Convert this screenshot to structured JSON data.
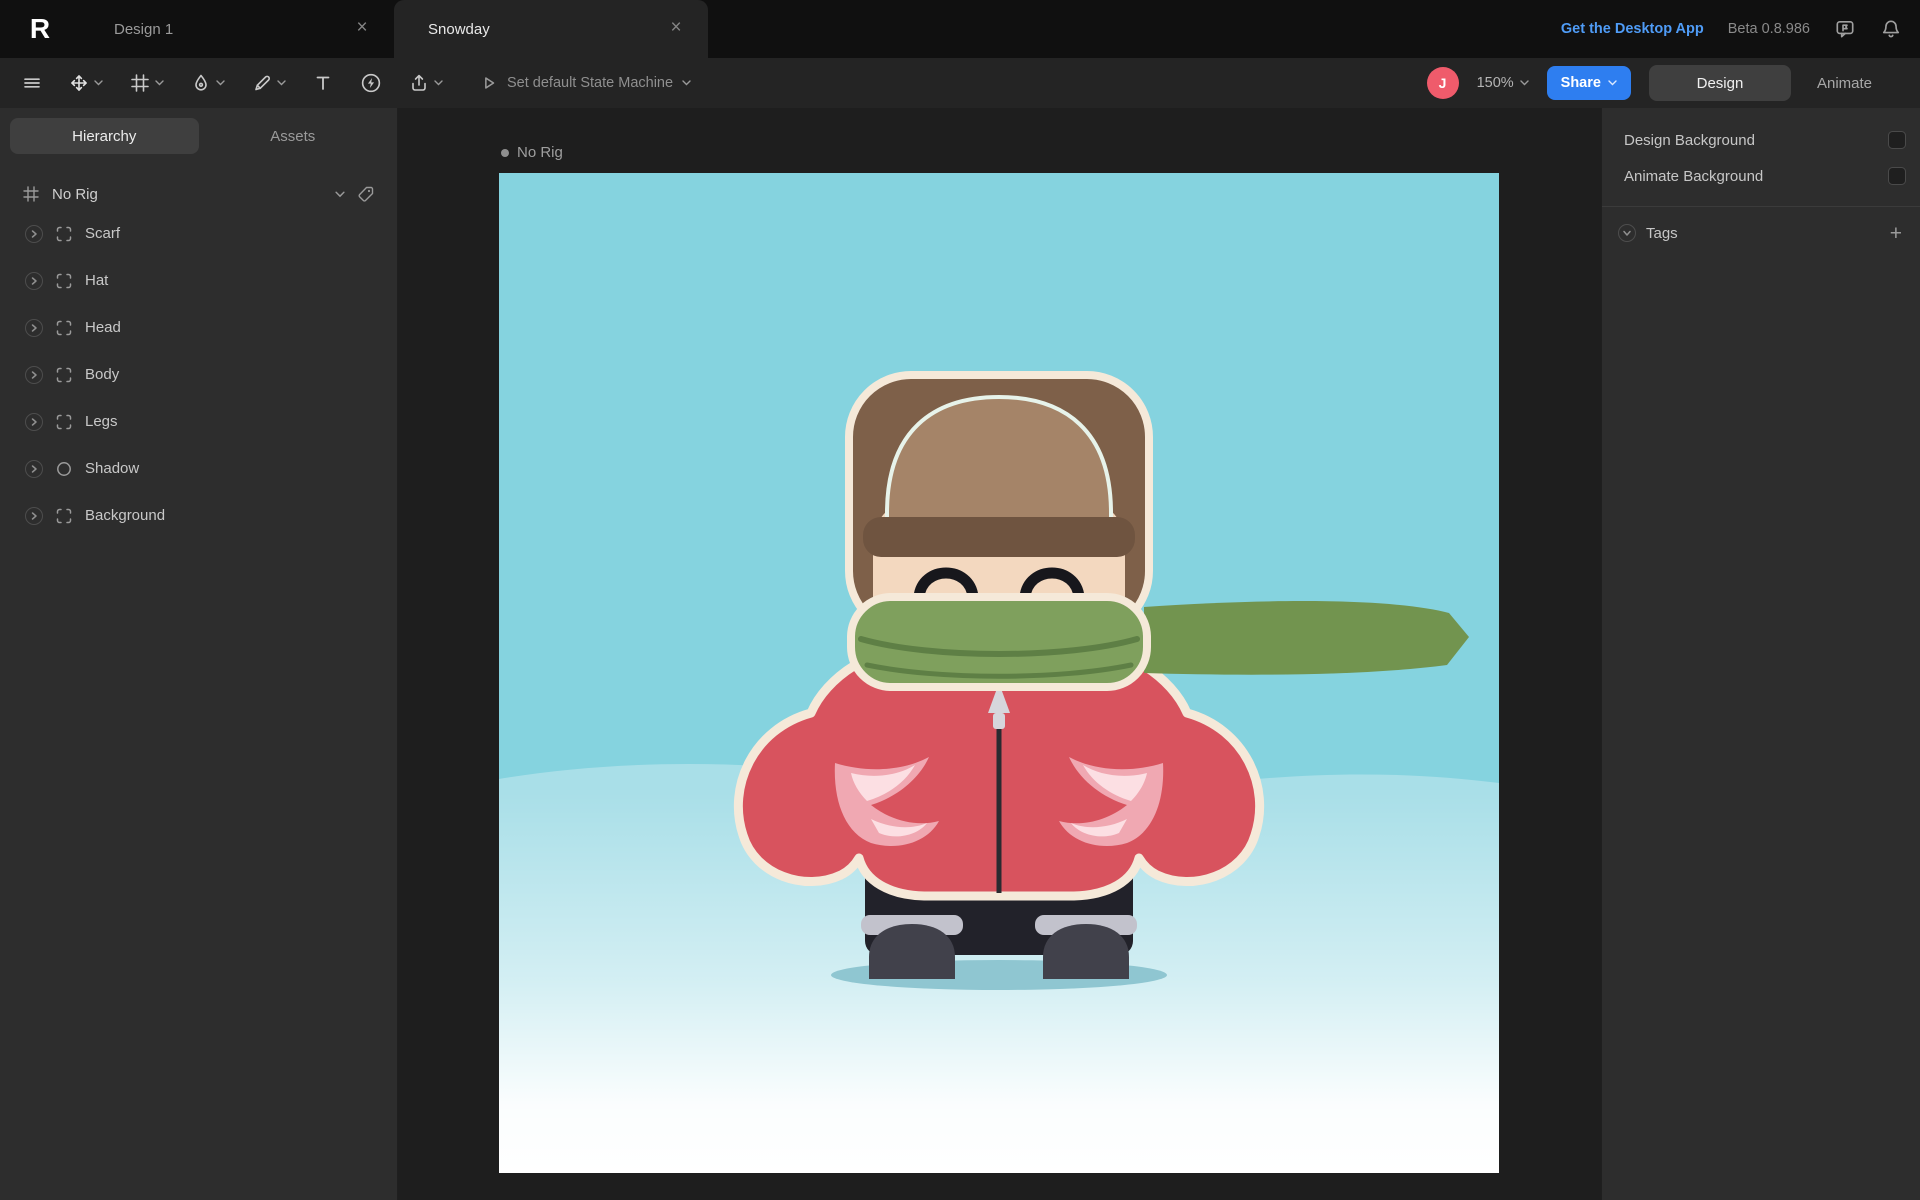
{
  "app": {
    "logo": "R"
  },
  "tabbar": {
    "tabs": [
      {
        "label": "Design 1",
        "close": "×"
      },
      {
        "label": "Snowday",
        "close": "×"
      }
    ],
    "desktop_link": "Get the Desktop App",
    "beta": "Beta 0.8.986",
    "icons": [
      "feedback-icon",
      "bell-icon"
    ]
  },
  "toolbar": {
    "icons": [
      "menu",
      "transform-tool",
      "artboard-tool",
      "pen-tool",
      "pencil-tool",
      "text-tool",
      "actions",
      "export",
      "play"
    ],
    "state_machine_label": "Set default State Machine",
    "avatar_initial": "J",
    "zoom": "150%",
    "share_label": "Share",
    "design_label": "Design",
    "animate_label": "Animate",
    "colors": {
      "share_blue": "#2e7ef0",
      "avatar_pink": "#ef5b6b",
      "link_blue": "#4f9cf7"
    }
  },
  "sidebar": {
    "tabs": {
      "hierarchy": "Hierarchy",
      "assets": "Assets"
    },
    "active_tab": "Hierarchy",
    "rig_selector": "No Rig",
    "tree": [
      {
        "label": "Scarf",
        "icon": "group-icon"
      },
      {
        "label": "Hat",
        "icon": "group-icon"
      },
      {
        "label": "Head",
        "icon": "group-icon"
      },
      {
        "label": "Body",
        "icon": "group-icon"
      },
      {
        "label": "Legs",
        "icon": "group-icon"
      },
      {
        "label": "Shadow",
        "icon": "ellipse-icon"
      },
      {
        "label": "Background",
        "icon": "group-icon"
      }
    ]
  },
  "canvas": {
    "artboard_label": "No Rig"
  },
  "right_panel": {
    "rows": [
      "Design Background",
      "Animate Background"
    ],
    "tags_label": "Tags",
    "swatch_color": "#1f1f1f"
  },
  "artwork": {
    "description": "winter character on snowy artboard",
    "colors": {
      "sky": "#85d3df",
      "hill": "#a9dfe8",
      "ground_shadow": "#8fc6d1",
      "hat_outer": "#7e6049",
      "hat_inner": "#a58468",
      "hat_front_outline": "#e7f3ea",
      "hat_brim": "#6f5440",
      "face": "#f3d8bf",
      "eyes": "#17171c",
      "scarf": "#7fa05d",
      "scarf_fold": "#5e7f45",
      "scarf_tail": "#72944f",
      "jacket": "#d8535e",
      "outline_cream": "#f5e9d9",
      "pocket_pink": "#f0a8b2",
      "pocket_light": "#fcdfe3",
      "zipper": "#2a2a30",
      "zipper_pull": "#d6d6dc",
      "pants": "#22222a",
      "boot": "#41414b",
      "boot_trim": "#c2c2cc"
    }
  }
}
